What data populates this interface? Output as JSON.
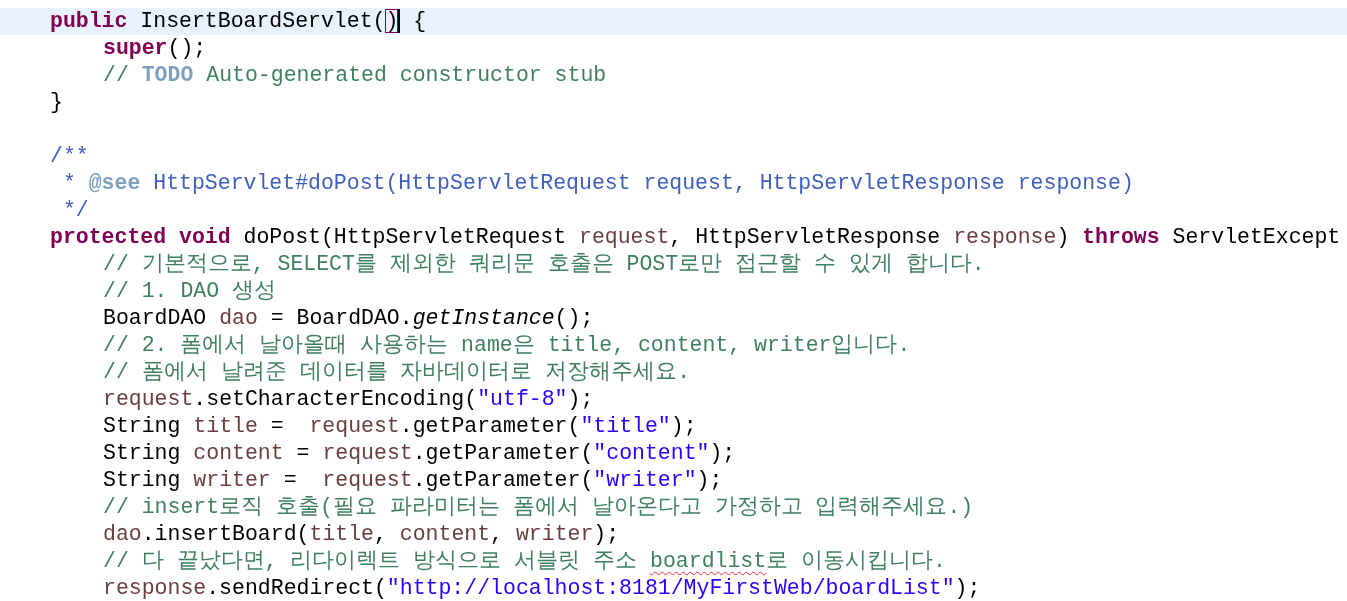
{
  "editor": {
    "lines": [
      {
        "kind": "code",
        "current": true,
        "tokens": [
          {
            "text": "public",
            "kind": "keyword"
          },
          {
            "text": " InsertBoardServlet(",
            "kind": "plain"
          },
          {
            "text": ")",
            "kind": "bracket",
            "caret": true
          },
          {
            "text": " {",
            "kind": "plain"
          }
        ],
        "children": [
          {
            "kind": "code",
            "tokens": [
              {
                "text": "super",
                "kind": "keyword"
              },
              {
                "text": "();",
                "kind": "plain"
              }
            ]
          },
          {
            "kind": "code",
            "tokens": [
              {
                "text": "// ",
                "kind": "comment"
              },
              {
                "text": "TODO",
                "kind": "todo"
              },
              {
                "text": " Auto-generated constructor stub",
                "kind": "comment"
              }
            ]
          }
        ]
      },
      {
        "kind": "code",
        "tokens": [
          {
            "text": "}",
            "kind": "plain"
          }
        ]
      },
      {
        "kind": "blank"
      },
      {
        "kind": "code",
        "tokens": [
          {
            "text": "/**",
            "kind": "javadoc"
          }
        ]
      },
      {
        "kind": "code",
        "tokens": [
          {
            "text": " * ",
            "kind": "javadoc"
          },
          {
            "text": "@see",
            "kind": "javadoc_tag"
          },
          {
            "text": " HttpServlet#doPost(HttpServletRequest request, HttpServletResponse response)",
            "kind": "javadoc"
          }
        ]
      },
      {
        "kind": "code",
        "tokens": [
          {
            "text": " */",
            "kind": "javadoc"
          }
        ]
      },
      {
        "kind": "code",
        "tokens": [
          {
            "text": "protected ",
            "kind": "keyword"
          },
          {
            "text": "void",
            "kind": "keyword"
          },
          {
            "text": " doPost(HttpServletRequest ",
            "kind": "plain"
          },
          {
            "text": "request",
            "kind": "local"
          },
          {
            "text": ", HttpServletResponse ",
            "kind": "plain"
          },
          {
            "text": "response",
            "kind": "local"
          },
          {
            "text": ") ",
            "kind": "plain"
          },
          {
            "text": "throws",
            "kind": "keyword"
          },
          {
            "text": " ServletExcept",
            "kind": "plain"
          }
        ],
        "children": [
          {
            "kind": "code",
            "tokens": [
              {
                "text": "// 기본적으로, SELECT를 제외한 쿼리문 호출은 POST로만 접근할 수 있게 합니다.",
                "kind": "comment"
              }
            ]
          },
          {
            "kind": "code",
            "tokens": [
              {
                "text": "// 1. DAO 생성",
                "kind": "comment"
              }
            ]
          },
          {
            "kind": "code",
            "tokens": [
              {
                "text": "BoardDAO ",
                "kind": "plain"
              },
              {
                "text": "dao",
                "kind": "local"
              },
              {
                "text": " = BoardDAO.",
                "kind": "plain"
              },
              {
                "text": "getInstance",
                "kind": "static"
              },
              {
                "text": "();",
                "kind": "plain"
              }
            ]
          },
          {
            "kind": "code",
            "tokens": [
              {
                "text": "// 2. 폼에서 날아올때 사용하는 name은 title, content, writer입니다.",
                "kind": "comment"
              }
            ]
          },
          {
            "kind": "code",
            "tokens": [
              {
                "text": "// 폼에서 날려준 데이터를 자바데이터로 저장해주세요.",
                "kind": "comment"
              }
            ]
          },
          {
            "kind": "code",
            "tokens": [
              {
                "text": "request",
                "kind": "local"
              },
              {
                "text": ".setCharacterEncoding(",
                "kind": "plain"
              },
              {
                "text": "\"utf-8\"",
                "kind": "string"
              },
              {
                "text": ");",
                "kind": "plain"
              }
            ]
          },
          {
            "kind": "code",
            "tokens": [
              {
                "text": "String ",
                "kind": "plain"
              },
              {
                "text": "title",
                "kind": "local"
              },
              {
                "text": " =  ",
                "kind": "plain"
              },
              {
                "text": "request",
                "kind": "local"
              },
              {
                "text": ".getParameter(",
                "kind": "plain"
              },
              {
                "text": "\"title\"",
                "kind": "string"
              },
              {
                "text": ");",
                "kind": "plain"
              }
            ]
          },
          {
            "kind": "code",
            "tokens": [
              {
                "text": "String ",
                "kind": "plain"
              },
              {
                "text": "content",
                "kind": "local"
              },
              {
                "text": " = ",
                "kind": "plain"
              },
              {
                "text": "request",
                "kind": "local"
              },
              {
                "text": ".getParameter(",
                "kind": "plain"
              },
              {
                "text": "\"content\"",
                "kind": "string"
              },
              {
                "text": ");",
                "kind": "plain"
              }
            ]
          },
          {
            "kind": "code",
            "tokens": [
              {
                "text": "String ",
                "kind": "plain"
              },
              {
                "text": "writer",
                "kind": "local"
              },
              {
                "text": " =  ",
                "kind": "plain"
              },
              {
                "text": "request",
                "kind": "local"
              },
              {
                "text": ".getParameter(",
                "kind": "plain"
              },
              {
                "text": "\"writer\"",
                "kind": "string"
              },
              {
                "text": ");",
                "kind": "plain"
              }
            ]
          },
          {
            "kind": "code",
            "tokens": [
              {
                "text": "// insert로직 호출(필요 파라미터는 폼에서 날아온다고 가정하고 입력해주세요.)",
                "kind": "comment"
              }
            ]
          },
          {
            "kind": "code",
            "tokens": [
              {
                "text": "dao",
                "kind": "local"
              },
              {
                "text": ".insertBoard(",
                "kind": "plain"
              },
              {
                "text": "title",
                "kind": "local"
              },
              {
                "text": ", ",
                "kind": "plain"
              },
              {
                "text": "content",
                "kind": "local"
              },
              {
                "text": ", ",
                "kind": "plain"
              },
              {
                "text": "writer",
                "kind": "local"
              },
              {
                "text": ");",
                "kind": "plain"
              }
            ]
          },
          {
            "kind": "code",
            "tokens": [
              {
                "text": "// 다 끝났다면, 리다이렉트 방식으로 서블릿 주소 ",
                "kind": "comment"
              },
              {
                "text": "boardlist",
                "kind": "misspelled"
              },
              {
                "text": "로 이동시킵니다.",
                "kind": "comment"
              }
            ]
          },
          {
            "kind": "code",
            "tokens": [
              {
                "text": "response",
                "kind": "local"
              },
              {
                "text": ".sendRedirect(",
                "kind": "plain"
              },
              {
                "text": "\"http://localhost:8181/MyFirstWeb/boardList\"",
                "kind": "string"
              },
              {
                "text": ");",
                "kind": "plain"
              }
            ]
          }
        ]
      }
    ]
  }
}
